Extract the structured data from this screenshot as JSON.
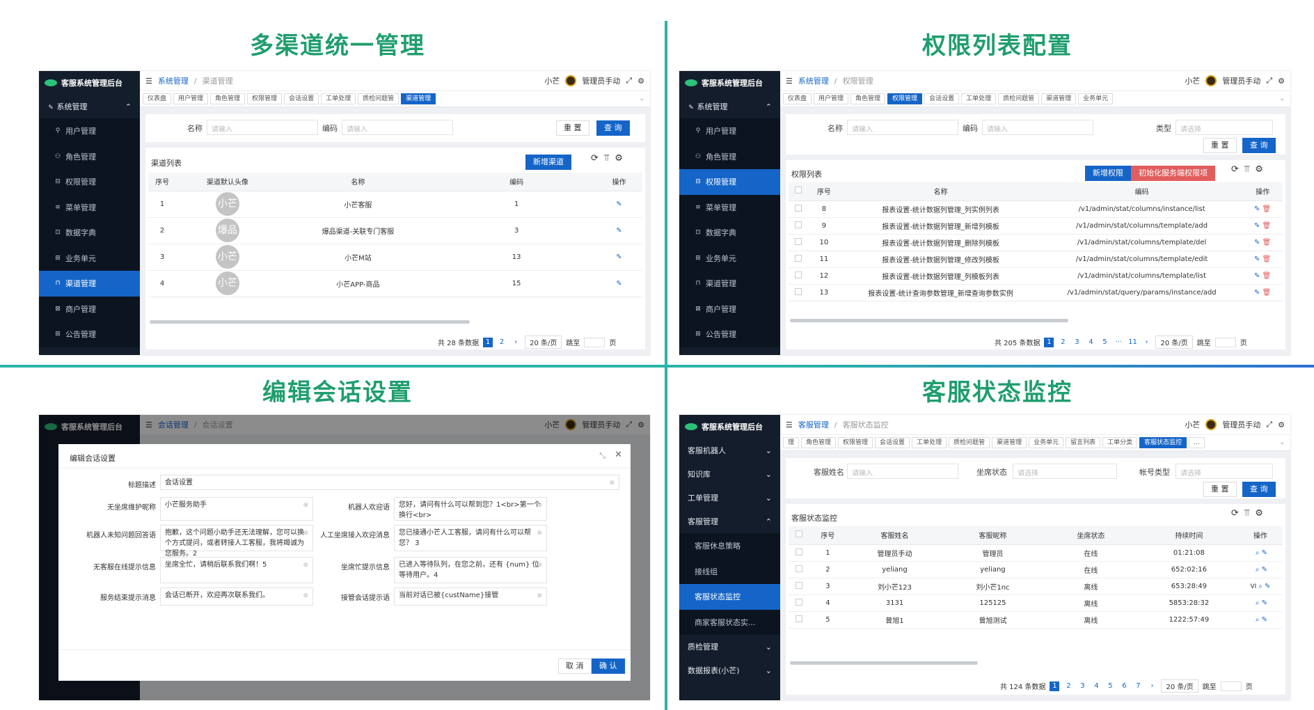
{
  "titles": {
    "q1": "多渠道统一管理",
    "q2": "权限列表配置",
    "q3": "编辑会话设置",
    "q4": "客服状态监控"
  },
  "app": {
    "name": "客服系统管理后台",
    "user_name": "小芒",
    "admin_label": "管理员手动"
  },
  "sidebar_a": {
    "group": "系统管理",
    "items": [
      "用户管理",
      "角色管理",
      "权限管理",
      "菜单管理",
      "数据字典",
      "业务单元",
      "渠道管理",
      "商户管理",
      "公告管理"
    ]
  },
  "sidebar_b": {
    "groups": [
      "客服机器人",
      "知识库",
      "工单管理",
      "客服管理"
    ],
    "items": [
      "客服休息策略",
      "接线组",
      "客服状态监控",
      "商家客服状态实..."
    ],
    "groups_after": [
      "质检管理",
      "数据报表(小芒)"
    ]
  },
  "q1": {
    "bc1": "系统管理",
    "bc2": "渠道管理",
    "tabs": [
      "仪表盘",
      "用户管理",
      "角色管理",
      "权限管理",
      "会话设置",
      "工单处理",
      "质检问题管",
      "渠道管理"
    ],
    "filters": [
      {
        "label": "名称",
        "placeholder": "请输入"
      },
      {
        "label": "编码",
        "placeholder": "请输入"
      }
    ],
    "reset": "重 置",
    "query": "查 询",
    "list_title": "渠道列表",
    "add": "新增渠道",
    "headers": [
      "序号",
      "渠道默认头像",
      "名称",
      "编码",
      "操作"
    ],
    "rows": [
      {
        "no": "1",
        "av": "小芒",
        "name": "小芒客服",
        "code": "1"
      },
      {
        "no": "2",
        "av": "爆品",
        "name": "爆品渠道-关联专门客服",
        "code": "3"
      },
      {
        "no": "3",
        "av": "小芒",
        "name": "小芒M站",
        "code": "13"
      },
      {
        "no": "4",
        "av": "小芒",
        "name": "小芒APP-商品",
        "code": "15"
      }
    ],
    "total": "共 28 条数据",
    "pages": [
      "1",
      "2"
    ],
    "page_size": "20 条/页",
    "jump": "跳至",
    "page_unit": "页"
  },
  "q2": {
    "bc1": "系统管理",
    "bc2": "权限管理",
    "tabs": [
      "仪表盘",
      "用户管理",
      "角色管理",
      "权限管理",
      "会话设置",
      "工单处理",
      "质检问题管",
      "渠道管理",
      "业务单元"
    ],
    "filters": [
      {
        "label": "名称",
        "placeholder": "请输入"
      },
      {
        "label": "编码",
        "placeholder": "请输入"
      },
      {
        "label": "类型",
        "placeholder": "请选择"
      }
    ],
    "reset": "重 置",
    "query": "查 询",
    "list_title": "权限列表",
    "add": "新增权限",
    "init": "初始化服务端权限项",
    "headers": [
      "序号",
      "名称",
      "编码",
      "操作"
    ],
    "rows": [
      {
        "no": "8",
        "name": "报表设置-统计数据列管理_列实例列表",
        "code": "/v1/admin/stat/columns/instance/list"
      },
      {
        "no": "9",
        "name": "报表设置-统计数据列管理_新增列模板",
        "code": "/v1/admin/stat/columns/template/add"
      },
      {
        "no": "10",
        "name": "报表设置-统计数据列管理_删除列模板",
        "code": "/v1/admin/stat/columns/template/del"
      },
      {
        "no": "11",
        "name": "报表设置-统计数据列管理_修改列模板",
        "code": "/v1/admin/stat/columns/template/edit"
      },
      {
        "no": "12",
        "name": "报表设置-统计数据列管理_列模板列表",
        "code": "/v1/admin/stat/columns/template/list"
      },
      {
        "no": "13",
        "name": "报表设置-统计查询参数管理_新增查询参数实例",
        "code": "/v1/admin/stat/query/params/instance/add"
      }
    ],
    "total": "共 205 条数据",
    "pages": [
      "1",
      "2",
      "3",
      "4",
      "5",
      "···",
      "11"
    ],
    "page_size": "20 条/页",
    "jump": "跳至",
    "page_unit": "页"
  },
  "q3": {
    "bc1": "会话管理",
    "bc2": "会话设置",
    "modal_title": "编辑会话设置",
    "title_label": "标题描述",
    "title_value": "会话设置",
    "fields": [
      {
        "l": "无坐席维护昵称",
        "v": "小芒服务助手",
        "r": "机器人欢迎语",
        "rv": "您好，请问有什么可以帮到您？1<br>第一个换行<br>"
      },
      {
        "l": "机器人未知问题回答语",
        "v": "抱歉，这个问题小助手还无法理解，您可以换个方式提问，或者转接人工客服，我将竭诚为您服务。2",
        "r": "人工坐席接入欢迎消息",
        "rv": "您已接通小芒人工客服，请问有什么可以帮您？ 3"
      },
      {
        "l": "无客服在线提示信息",
        "v": "坐席全忙，请稍后联系我们啊！5",
        "r": "坐席忙提示信息",
        "rv": "已进入等待队列，在您之前，还有 {num} 位等待用户。4"
      },
      {
        "l": "服务结束提示消息",
        "v": "会话已断开，欢迎再次联系我们。",
        "r": "接管会话提示语",
        "rv": "当前对话已被{custName}接管"
      }
    ],
    "cancel": "取 消",
    "ok": "确 认"
  },
  "q4": {
    "bc1": "客服管理",
    "bc2": "客服状态监控",
    "tabs": [
      "理",
      "角色管理",
      "权限管理",
      "会话设置",
      "工单处理",
      "质检问题管",
      "渠道管理",
      "业务单元",
      "留言列表",
      "工单分类",
      "客服状态监控",
      "..."
    ],
    "filters": [
      {
        "label": "客服姓名",
        "placeholder": "请输入"
      },
      {
        "label": "坐席状态",
        "placeholder": "请选择"
      },
      {
        "label": "帐号类型",
        "placeholder": "请选择"
      }
    ],
    "reset": "重 置",
    "query": "查 询",
    "list_title": "客服状态监控",
    "headers": [
      "序号",
      "客服姓名",
      "客服昵称",
      "坐席状态",
      "持续时间",
      "操作"
    ],
    "rows": [
      {
        "no": "1",
        "name": "管理员手动",
        "nick": "管理员",
        "st": "在线",
        "dur": "01:21:08",
        "x": ""
      },
      {
        "no": "2",
        "name": "yeliang",
        "nick": "yeliang",
        "st": "在线",
        "dur": "652:02:16",
        "x": ""
      },
      {
        "no": "3",
        "name": "刘小芒123",
        "nick": "刘小芒1nc",
        "st": "离线",
        "dur": "653:28:49",
        "x": "VI"
      },
      {
        "no": "4",
        "name": "3131",
        "nick": "125125",
        "st": "离线",
        "dur": "5853:28:32",
        "x": ""
      },
      {
        "no": "5",
        "name": "曾旭1",
        "nick": "曾旭测试",
        "st": "离线",
        "dur": "1222:57:49",
        "x": ""
      }
    ],
    "total": "共 124 条数据",
    "pages": [
      "1",
      "2",
      "3",
      "4",
      "5",
      "6",
      "7"
    ],
    "page_size": "20 条/页",
    "jump": "跳至",
    "page_unit": "页"
  }
}
